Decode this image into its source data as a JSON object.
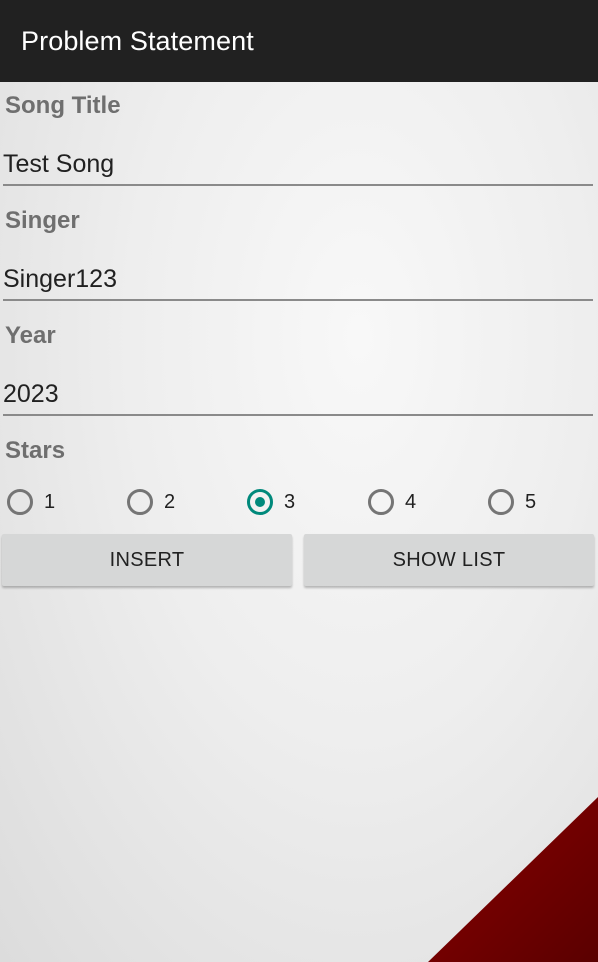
{
  "app_bar": {
    "title": "Problem Statement"
  },
  "form": {
    "song_title": {
      "label": "Song Title",
      "value": "Test Song"
    },
    "singer": {
      "label": "Singer",
      "value": "Singer123"
    },
    "year": {
      "label": "Year",
      "value": "2023"
    },
    "stars": {
      "label": "Stars",
      "options": [
        "1",
        "2",
        "3",
        "4",
        "5"
      ],
      "selected": "3"
    }
  },
  "buttons": {
    "insert": "INSERT",
    "show_list": "SHOW LIST"
  },
  "colors": {
    "app_bar": "#212121",
    "accent": "#00897b",
    "button_bg": "#d6d7d7",
    "corner": "#8b0000"
  }
}
